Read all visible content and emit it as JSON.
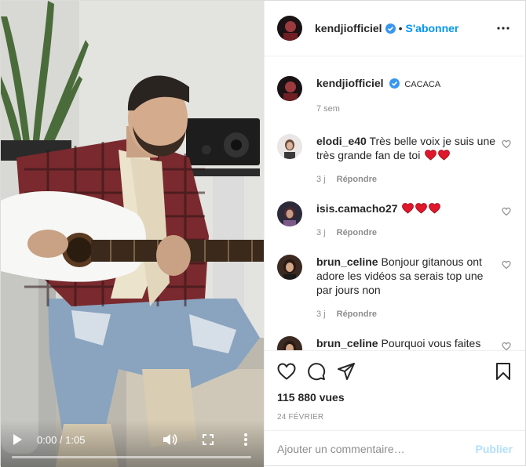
{
  "header": {
    "username": "kendjiofficiel",
    "separator": "•",
    "follow_label": "S'abonner"
  },
  "caption": {
    "username": "kendjiofficiel",
    "text": "CACACA",
    "time_ago": "7 sem"
  },
  "comments": [
    {
      "username": "elodi_e40",
      "text": "Très belle voix je suis une très grande fan de toi",
      "hearts": 2,
      "time_ago": "3 j",
      "reply_label": "Répondre"
    },
    {
      "username": "isis.camacho27",
      "text": "",
      "hearts": 3,
      "time_ago": "3 j",
      "reply_label": "Répondre"
    },
    {
      "username": "brun_celine",
      "text": "Bonjour gitanous ont adore les vidéos sa serais top une par jours non",
      "hearts": 0,
      "time_ago": "3 j",
      "reply_label": "Répondre"
    },
    {
      "username": "brun_celine",
      "text": "Pourquoi vous faites",
      "hearts": 0,
      "time_ago": "",
      "reply_label": ""
    }
  ],
  "video": {
    "time_display": "0:00 / 1:05",
    "progress": 0
  },
  "stats": {
    "views": "115 880 vues",
    "date": "24 FÉVRIER"
  },
  "add_comment": {
    "placeholder": "Ajouter un commentaire…",
    "publish_label": "Publier"
  },
  "colors": {
    "accent": "#0095f6",
    "publish_disabled": "#b2dffc",
    "heart_emoji": "#e0162b",
    "verified": "#3897f0"
  }
}
